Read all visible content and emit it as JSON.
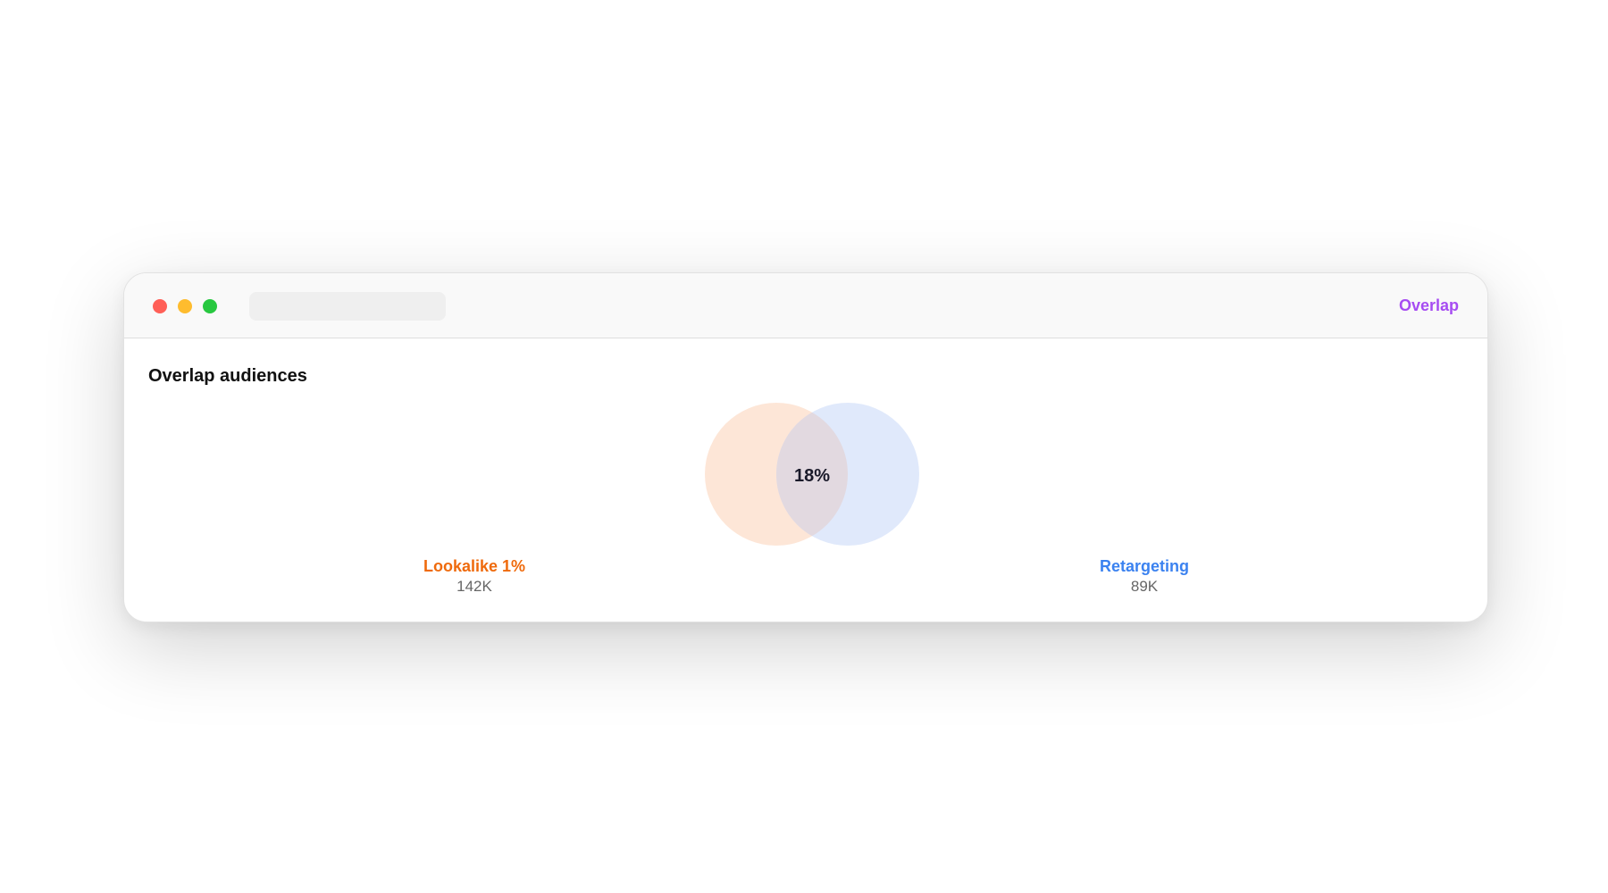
{
  "window": {
    "header_link": "Overlap"
  },
  "section": {
    "title": "Overlap audiences"
  },
  "venn": {
    "overlap_label": "18%",
    "audiences": [
      {
        "name": "Lookalike 1%",
        "count": "142K",
        "color": "#fde3d3"
      },
      {
        "name": "Retargeting",
        "count": "89K",
        "color": "#dde7fb"
      }
    ]
  },
  "colors": {
    "accent": "#a64cf2",
    "audience_a_text": "#ef6a0c",
    "audience_b_text": "#3b82f0"
  }
}
